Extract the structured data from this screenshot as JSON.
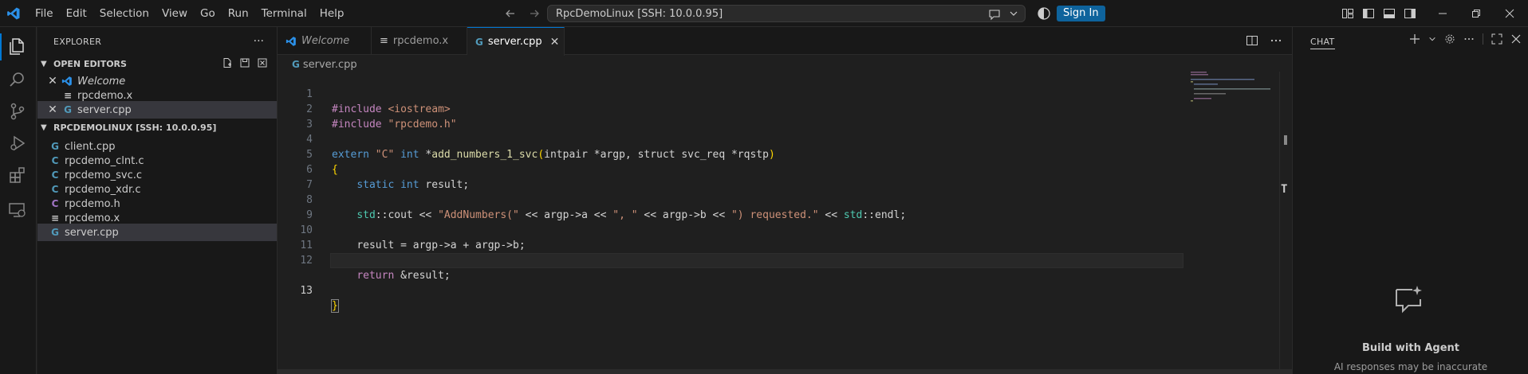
{
  "titlebar": {
    "menu": [
      "File",
      "Edit",
      "Selection",
      "View",
      "Go",
      "Run",
      "Terminal",
      "Help"
    ],
    "command_center": "RpcDemoLinux [SSH: 10.0.0.95]",
    "sign_in": "Sign In"
  },
  "activity_bar": {
    "items": [
      "explorer-icon",
      "search-icon",
      "source-control-icon",
      "run-debug-icon",
      "extensions-icon",
      "remote-explorer-icon"
    ]
  },
  "sidebar": {
    "title": "EXPLORER",
    "more": "···",
    "open_editors": {
      "header": "OPEN EDITORS",
      "items": [
        {
          "name": "Welcome",
          "icon": "vscode-icon"
        },
        {
          "name": "rpcdemo.x",
          "icon": "lines-icon"
        },
        {
          "name": "server.cpp",
          "icon": "cpp-icon"
        }
      ]
    },
    "workspace": {
      "header": "RPCDEMOLINUX [SSH: 10.0.0.95]",
      "files": [
        {
          "name": "client.cpp",
          "icon": "cpp-icon"
        },
        {
          "name": "rpcdemo_clnt.c",
          "icon": "c-icon"
        },
        {
          "name": "rpcdemo_svc.c",
          "icon": "c-icon"
        },
        {
          "name": "rpcdemo_xdr.c",
          "icon": "c-icon"
        },
        {
          "name": "rpcdemo.h",
          "icon": "h-icon"
        },
        {
          "name": "rpcdemo.x",
          "icon": "lines-icon"
        },
        {
          "name": "server.cpp",
          "icon": "cpp-icon"
        }
      ]
    }
  },
  "tabs": [
    {
      "label": "Welcome"
    },
    {
      "label": "rpcdemo.x"
    },
    {
      "label": "server.cpp"
    }
  ],
  "breadcrumb": "server.cpp",
  "code": {
    "line_numbers": [
      "1",
      "2",
      "3",
      "4",
      "5",
      "6",
      "7",
      "8",
      "9",
      "10",
      "11",
      "12",
      "13"
    ],
    "lines": {
      "l1_directive": "#include",
      "l1_header": "<iostream>",
      "l2_directive": "#include",
      "l2_header": "\"rpcdemo.h\"",
      "l4_extern": "extern",
      "l4_c": "\"C\"",
      "l4_int": "int",
      "l4_star": "*",
      "l4_fn": "add_numbers_1_svc",
      "l4_open": "(",
      "l4_type1": "intpair",
      "l4_p1": "*argp",
      "l4_comma": ",",
      "l4_struct": "struct",
      "l4_type2": "svc_req",
      "l4_p2": "*rqstp",
      "l4_close": ")",
      "l5_brace": "{",
      "l6_static": "static",
      "l6_int": "int",
      "l6_var": "result",
      "l6_semi": ";",
      "l8_std1": "std",
      "l8_sep1": "::",
      "l8_cout": "cout",
      "l8_op1": " << ",
      "l8_s1": "\"AddNumbers(\"",
      "l8_op2": " << ",
      "l8_argp1": "argp",
      "l8_arrow1": "->",
      "l8_a": "a",
      "l8_op3": " << ",
      "l8_s2": "\", \"",
      "l8_op4": " << ",
      "l8_argp2": "argp",
      "l8_arrow2": "->",
      "l8_b": "b",
      "l8_op5": " << ",
      "l8_s3": "\") requested.\"",
      "l8_op6": " << ",
      "l8_std2": "std",
      "l8_sep2": "::",
      "l8_endl": "endl",
      "l8_semi": ";",
      "l10_result": "result",
      "l10_eq": " = ",
      "l10_argp1": "argp",
      "l10_arrow1": "->",
      "l10_a": "a",
      "l10_plus": " + ",
      "l10_argp2": "argp",
      "l10_arrow2": "->",
      "l10_b": "b",
      "l10_semi": ";",
      "l12_return": "return",
      "l12_amp": " &",
      "l12_result": "result",
      "l12_semi": ";",
      "l13_brace": "}"
    }
  },
  "scroll_marker": "T",
  "chat": {
    "title": "CHAT",
    "heading": "Build with Agent",
    "subtext": "AI responses may be inaccurate"
  },
  "colors": {
    "accent": "#0078d4",
    "signin": "#0e639c",
    "background": "#1f1f1f",
    "sidebar": "#181818"
  }
}
